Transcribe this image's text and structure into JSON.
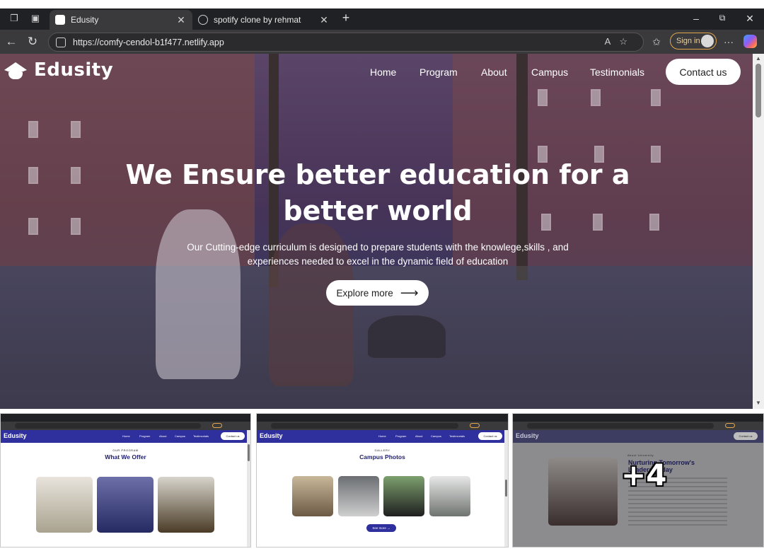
{
  "browser": {
    "tabs": [
      {
        "title": "Edusity",
        "active": true
      },
      {
        "title": "spotify clone by rehmat",
        "active": false
      }
    ],
    "url": "https://comfy-cendol-b1f477.netlify.app",
    "sign_in_label": "Sign in",
    "window_controls": [
      "minimize-icon",
      "restore-icon",
      "close-icon"
    ]
  },
  "site": {
    "brand": "Edusity",
    "nav": [
      "Home",
      "Program",
      "About",
      "Campus",
      "Testimonials"
    ],
    "contact_label": "Contact us",
    "hero": {
      "title_line1": "We Ensure better education for a",
      "title_line2": "better world",
      "subtitle_line1": "Our Cutting-edge curriculum is designed to prepare students with the knowlege,skills , and",
      "subtitle_line2": "experiences needed to excel in the dynamic field of education",
      "cta_label": "Explore more",
      "cta_icon": "arrow-right-icon"
    }
  },
  "thumbnails": [
    {
      "subtitle": "OUR PROGRAM",
      "heading": "What We Offer"
    },
    {
      "subtitle": "GALLERY",
      "heading": "Campus Photos",
      "button": "See more"
    },
    {
      "subtitle": "About University",
      "heading_line1": "Nurturing Tomorrow's",
      "heading_line2": "Leaders Today",
      "overlay": "+4"
    }
  ],
  "colors": {
    "tabbar": "#202124",
    "toolbar": "#3a3a3d",
    "hero_overlay": "#2a1f6b",
    "accent": "#2f2f9e",
    "signin_border": "#e3a64a"
  }
}
